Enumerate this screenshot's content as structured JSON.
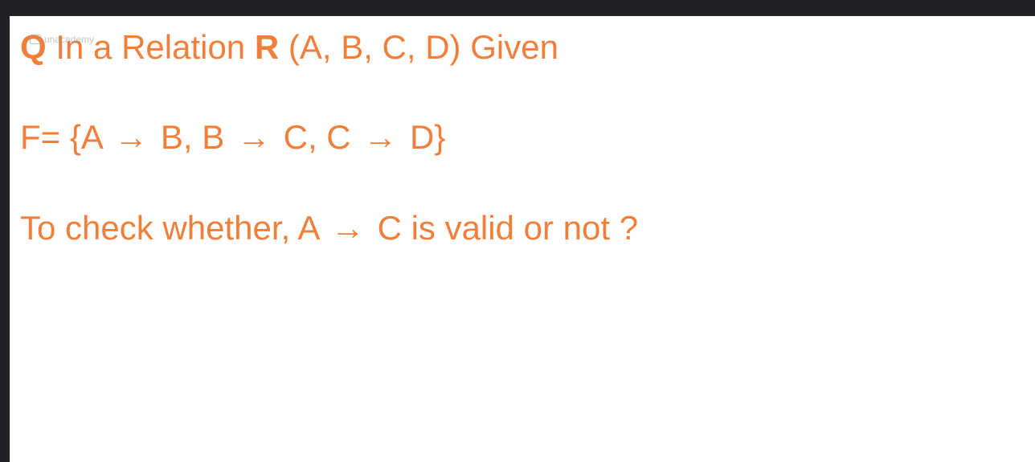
{
  "watermark": {
    "text": "unacademy",
    "icon": "unacademy-logo-icon"
  },
  "slide": {
    "line1": {
      "q": "Q",
      "prefix": "In a Relation ",
      "relation": "R",
      "suffix": " (A, B, C, D) Given"
    },
    "line2": {
      "prefix": "F= {A",
      "arrow1": "→",
      "part1": " B, B",
      "arrow2": "→",
      "part2": " C, C",
      "arrow3": "→",
      "part3": " D}"
    },
    "line3": {
      "prefix": "To check whether, A",
      "arrow": "→",
      "suffix": " C is valid or not ?"
    }
  },
  "colors": {
    "background": "#202124",
    "slide_background": "#ffffff",
    "text": "#f07f3c"
  }
}
